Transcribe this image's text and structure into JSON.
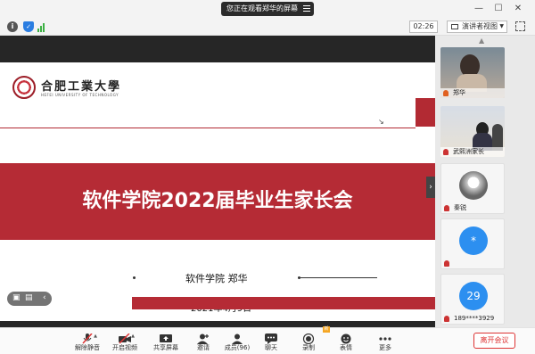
{
  "titlebar": {
    "sharing_notice": "您正在观看郑华的屏幕",
    "min": "—",
    "max": "☐",
    "close": "✕"
  },
  "toolbar": {
    "info": "i",
    "shield": "✓",
    "time": "02:26",
    "speaker_view": "演讲者视图",
    "caret": "▼"
  },
  "slide": {
    "logo_cn": "合肥工業大學",
    "logo_en": "HEFEI UNIVERSITY OF TECHNOLOGY",
    "title": "软件学院2022届毕业生家长会",
    "presenter": "软件学院  郑华",
    "date": "2021年4月9日",
    "nav_prev": "‹",
    "nav_next": "›"
  },
  "participants": [
    {
      "name": "郑华",
      "type": "video",
      "muted": false
    },
    {
      "name": "武熙洲家长",
      "type": "video",
      "muted": true
    },
    {
      "name": "秦锐",
      "type": "avatar",
      "muted": true
    },
    {
      "name": "",
      "type": "avatar-letter",
      "initial": "*",
      "muted": true
    },
    {
      "name": "189****3929",
      "type": "avatar-letter",
      "initial": "29",
      "muted": true
    }
  ],
  "bottom_toolbar": {
    "unmute": "解除静音",
    "start_video": "开启视频",
    "share_screen": "共享屏幕",
    "invite": "邀请",
    "members": "成员(96)",
    "chat": "聊天",
    "record": "录制",
    "reactions": "表情",
    "more": "更多",
    "leave": "离开会议",
    "rec_badge": "新"
  },
  "colors": {
    "brand_red": "#b52b35",
    "accent_blue": "#2c8ff0",
    "leave_red": "#dd3333"
  }
}
